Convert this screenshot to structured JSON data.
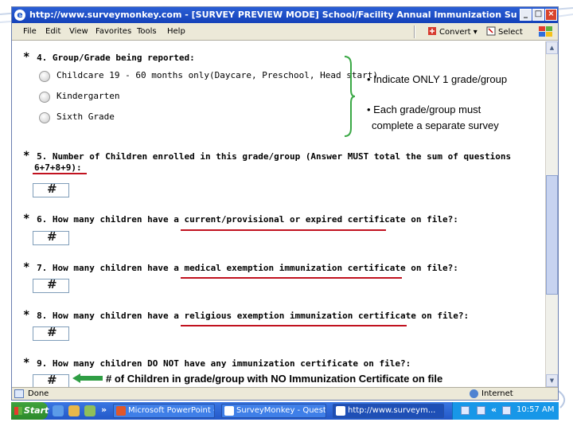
{
  "window": {
    "title": "http://www.surveymonkey.com - [SURVEY PREVIEW MODE] School/Facility Annual Immunization Survey - Microsoft Internet Ex..."
  },
  "menubar": {
    "items": [
      "File",
      "Edit",
      "View",
      "Favorites",
      "Tools",
      "Help"
    ],
    "convert_label": "Convert",
    "select_label": "Select"
  },
  "survey": {
    "q4": {
      "title": "4. Group/Grade being reported:",
      "options": [
        "Childcare 19 - 60 months only(Daycare, Preschool, Head start)",
        "Kindergarten",
        "Sixth Grade"
      ]
    },
    "q5": {
      "title_line1": "5. Number of Children enrolled in this grade/group (Answer MUST total the sum of questions",
      "title_line2": "6+7+8+9):"
    },
    "q6": {
      "title": "6. How many children have a current/provisional or expired certificate on file?:"
    },
    "q7": {
      "title": "7. How many children have a medical exemption immunization certificate on file?:"
    },
    "q8": {
      "title": "8. How many children have a religious exemption immunization certificate on file?:"
    },
    "q9": {
      "title": "9. How many children DO NOT have any immunization certificate on file?:"
    },
    "input_hash": "#",
    "star": "*"
  },
  "annotations": {
    "note1": "• Indicate ONLY 1 grade/group",
    "note2_line1": "• Each grade/group must",
    "note2_line2": "complete a separate survey",
    "arrow_note": "# of Children in grade/group with NO Immunization Certificate on file"
  },
  "statusbar": {
    "left": "Done",
    "right": "Internet"
  },
  "taskbar": {
    "start_label": "Start",
    "more": "»",
    "tasks": [
      "Microsoft PowerPoint - [...",
      "SurveyMonkey - Questio...",
      "http://www.surveym..."
    ],
    "clock": "10:57 AM",
    "tray_more": "«"
  },
  "colors": {
    "accent_red": "#c1121f",
    "bracket_green": "#3aa845",
    "arrow_green": "#2f9e44",
    "titlebar_blue": "#1441b8"
  }
}
